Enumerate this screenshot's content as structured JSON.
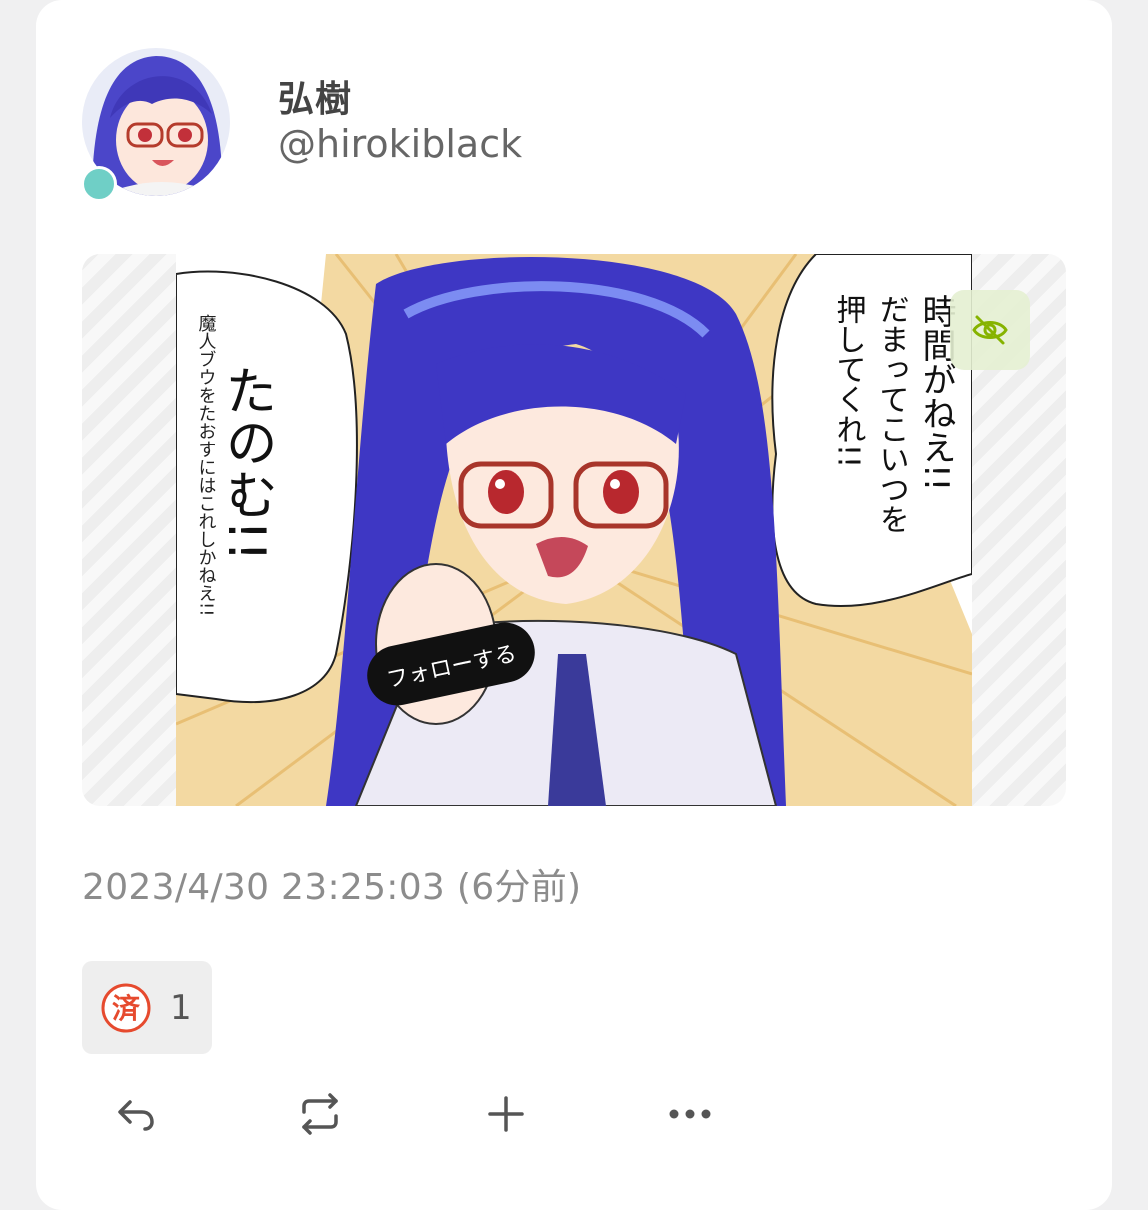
{
  "note": {
    "user": {
      "display_name": "弘樹",
      "username": "@hirokiblack",
      "avatar_icon": "avatar-image",
      "online_status_color": "#6fcfc6"
    },
    "media": {
      "icon": "sensitive-toggle-eye-slash-icon",
      "speech_main": "たのむ!!",
      "speech_side": "魔人ブウをたおすにはこれしかねえ!!",
      "speech_right_1": "時間がねえ!!",
      "speech_right_2": "だまってこいつを",
      "speech_right_3": "押してくれ!!",
      "button_text": "フォローする"
    },
    "timestamp": "2023/4/30 23:25:03 (6分前)",
    "reaction": {
      "emoji_char": "済",
      "count": "1",
      "emoji_color": "#e64a2e"
    },
    "actions": [
      {
        "name": "reply-icon"
      },
      {
        "name": "renote-icon"
      },
      {
        "name": "add-reaction-icon"
      },
      {
        "name": "more-icon"
      }
    ]
  },
  "colors": {
    "accent_green": "#86b300",
    "text_primary": "#444444",
    "text_muted": "#8c8c8c"
  }
}
